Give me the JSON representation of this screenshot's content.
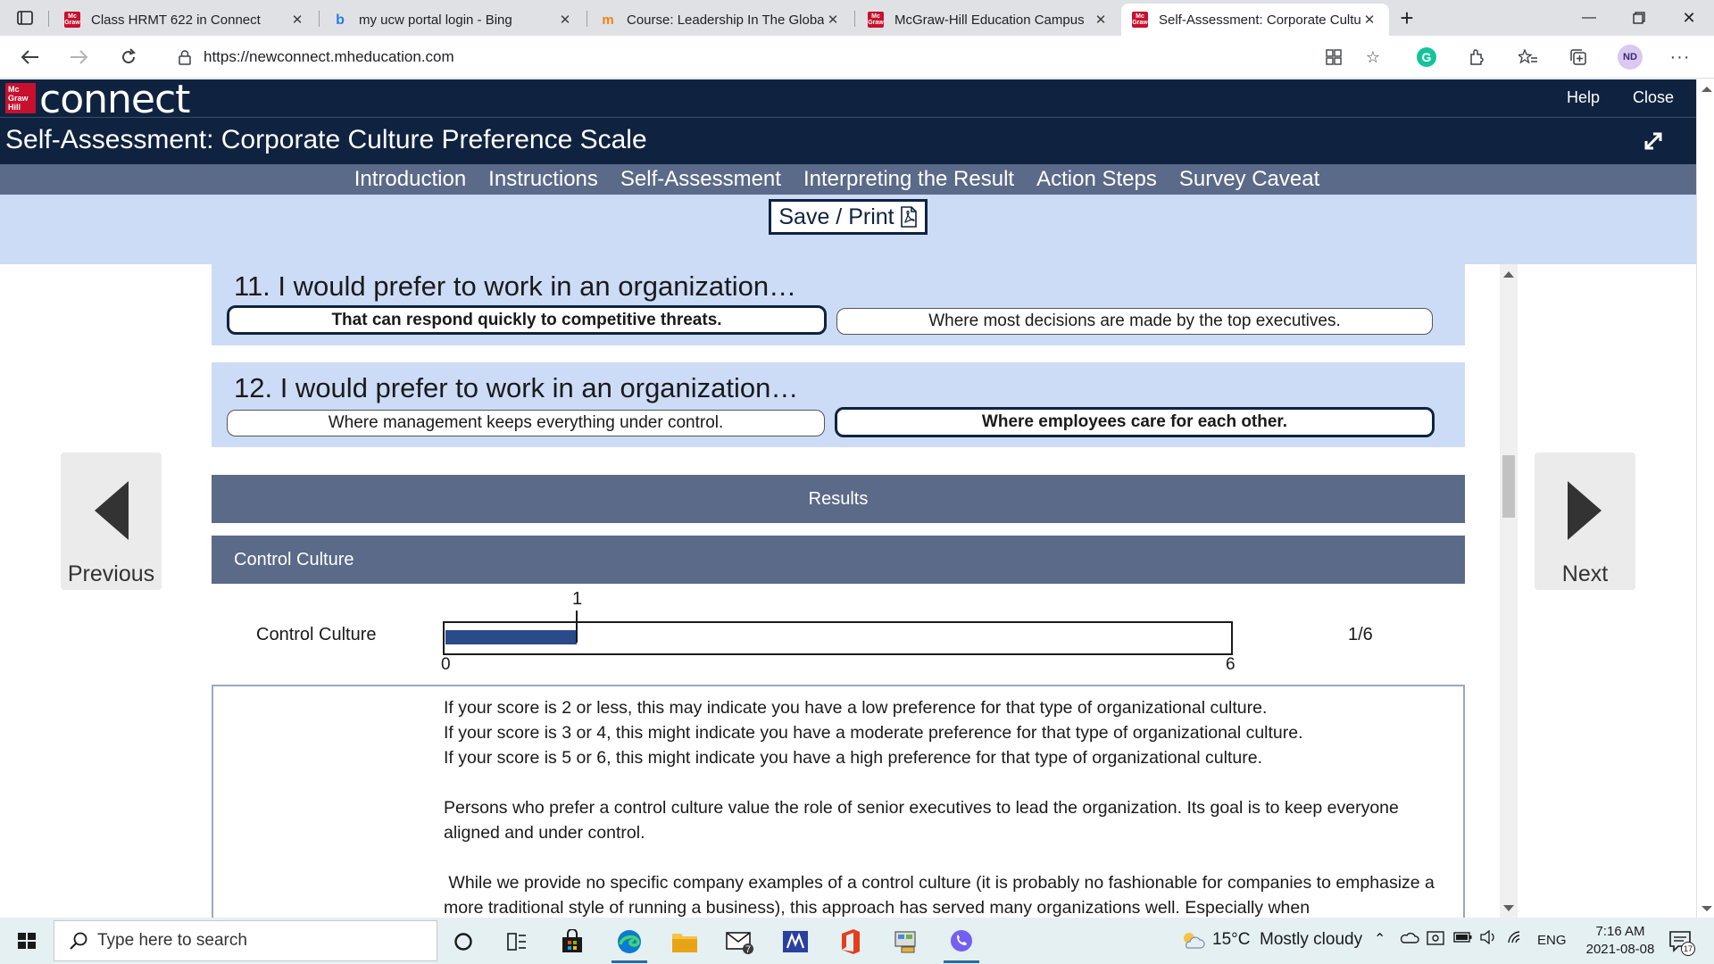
{
  "browser": {
    "tabs": [
      {
        "title": "Class HRMT 622 in Connect",
        "favicon": "mcgraw-hill-icon",
        "active": false
      },
      {
        "title": "my ucw portal login - Bing",
        "favicon": "bing-icon",
        "active": false
      },
      {
        "title": "Course: Leadership In The Global",
        "favicon": "moodle-icon",
        "active": false
      },
      {
        "title": "McGraw-Hill Education Campus",
        "favicon": "mcgraw-hill-icon",
        "active": false
      },
      {
        "title": "Self-Assessment: Corporate Cultu",
        "favicon": "mcgraw-hill-icon",
        "active": true
      }
    ],
    "url": "https://newconnect.mheducation.com",
    "profile_initials": "ND"
  },
  "app": {
    "logo_text": "Mc Graw Hill",
    "brand": "connect",
    "header_links": {
      "help": "Help",
      "close": "Close"
    },
    "page_title": "Self-Assessment: Corporate Culture Preference Scale",
    "nav_tabs": [
      "Introduction",
      "Instructions",
      "Self-Assessment",
      "Interpreting the Result",
      "Action Steps",
      "Survey Caveat"
    ],
    "save_print": "Save / Print"
  },
  "questions": [
    {
      "title": "11. I would prefer to work in an organization…",
      "options": [
        "That can respond quickly to competitive threats.",
        "Where most decisions are made by the top executives."
      ],
      "selected": 0
    },
    {
      "title": "12. I would prefer to work in an organization…",
      "options": [
        "Where management keeps everything under control.",
        "Where employees care for each other."
      ],
      "selected": 1
    }
  ],
  "side_nav": {
    "previous": "Previous",
    "next": "Next"
  },
  "results": {
    "header": "Results",
    "culture_header": "Control Culture",
    "score_label": "Control Culture",
    "score": 1,
    "score_max": 6,
    "score_min": 0,
    "score_text": "1",
    "min_text": "0",
    "max_text": "6",
    "fraction": "1/6",
    "bar_color": "#2a4a8a"
  },
  "interpretation": {
    "lines": [
      "If your score is 2 or less, this may indicate you have a low preference for that type of organizational culture.",
      "If your score is 3 or 4, this might indicate you have a moderate preference for that type of organizational culture.",
      "If your score is 5 or 6, this might indicate you have a high preference for that type of organizational culture."
    ],
    "para1": "Persons who prefer a control culture value the role of senior executives to lead the organization. Its goal is to keep everyone aligned and under control.",
    "para2": " While we provide no specific company examples of a control culture (it is probably no fashionable for companies to emphasize a more traditional style of running a business), this approach has served many organizations well. Especially when"
  },
  "taskbar": {
    "search_placeholder": "Type here to search",
    "weather": "15°C  Mostly cloudy",
    "language": "ENG",
    "time": "7:16 AM",
    "date": "2021-08-08",
    "mail_badge": "7",
    "notification_count": "17"
  },
  "colors": {
    "navy": "#0f2340",
    "nav_strip": "#5a6a88",
    "light_blue": "#ccdcf7",
    "brand_red": "#c8102e"
  }
}
